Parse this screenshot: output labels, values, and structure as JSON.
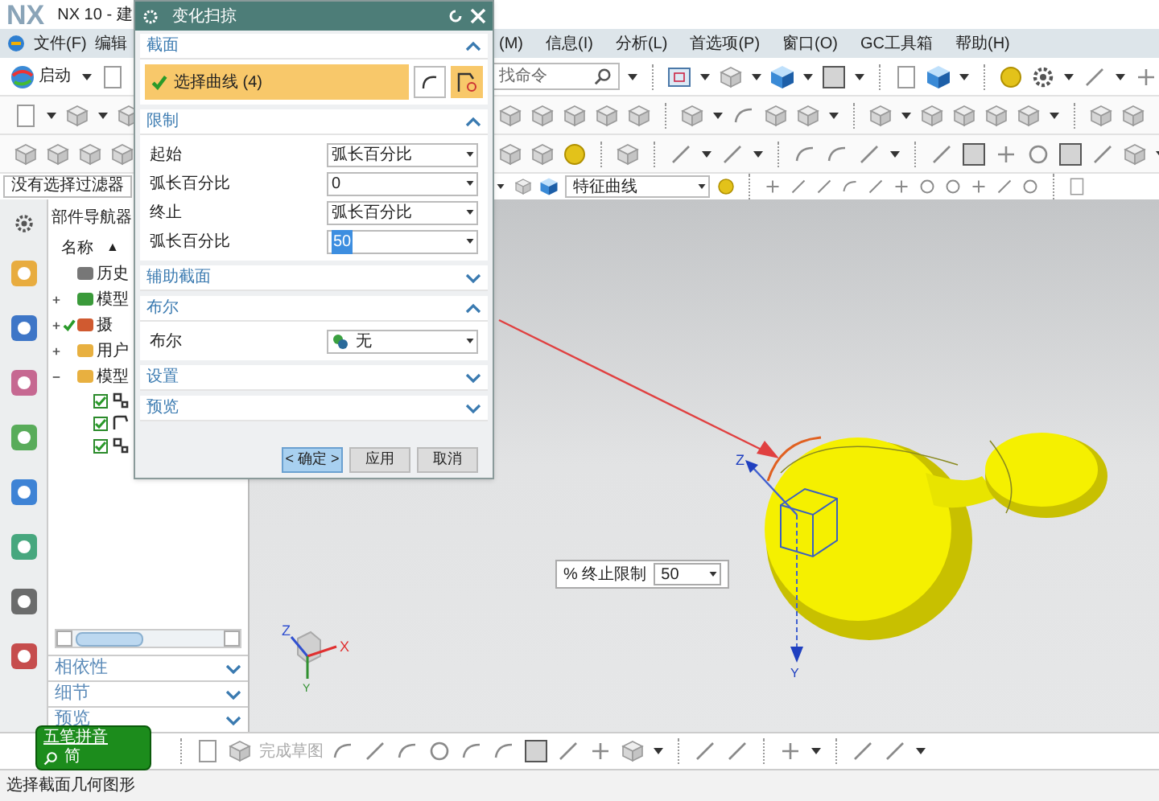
{
  "title_bar": {
    "logo": "NX",
    "title": "NX 10 - 建"
  },
  "menu_left": [
    "文件(F)",
    "编辑"
  ],
  "menu_right": [
    "(M)",
    "信息(I)",
    "分析(L)",
    "首选项(P)",
    "窗口(O)",
    "GC工具箱",
    "帮助(H)"
  ],
  "toolbar": {
    "start": "启动",
    "search": {
      "placeholder": "找命令"
    }
  },
  "selection_bar": {
    "filter": "没有选择过滤器",
    "curve_rule": "特征曲线"
  },
  "navigator": {
    "title": "部件导航器",
    "column": "名称",
    "sort_mark": "▲",
    "tree": [
      {
        "kind": "history",
        "label": "历史",
        "checked": false
      },
      {
        "kind": "views",
        "label": "模型",
        "checked": false,
        "expanded": false
      },
      {
        "kind": "camera",
        "label": "摄",
        "checked": true,
        "expanded": false
      },
      {
        "kind": "folder",
        "label": "用户",
        "checked": false,
        "expanded": false
      },
      {
        "kind": "folder",
        "label": "模型",
        "checked": false,
        "expanded": true,
        "children": [
          {
            "kind": "sketch",
            "checked": true
          },
          {
            "kind": "curve",
            "checked": true
          },
          {
            "kind": "sweep",
            "checked": true
          }
        ]
      }
    ],
    "panels": [
      {
        "label": "相依性",
        "expanded": false
      },
      {
        "label": "细节",
        "expanded": false
      },
      {
        "label": "预览",
        "expanded": false
      }
    ]
  },
  "dialog": {
    "title": "变化扫掠",
    "sections": [
      {
        "kind": "selection",
        "title": "截面",
        "expanded": true,
        "selection": {
          "label": "选择曲线 (4)",
          "done": true
        }
      },
      {
        "kind": "fields",
        "title": "限制",
        "expanded": true,
        "rows": [
          {
            "label": "起始",
            "value": "弧长百分比",
            "highlighted": false
          },
          {
            "label": "弧长百分比",
            "value": "0",
            "highlighted": false
          },
          {
            "label": "终止",
            "value": "弧长百分比",
            "highlighted": false
          },
          {
            "label": "弧长百分比",
            "value": "50",
            "highlighted": true
          }
        ]
      },
      {
        "title": "辅助截面",
        "expanded": false
      },
      {
        "kind": "boolean",
        "title": "布尔",
        "expanded": true,
        "rows": [
          {
            "label": "布尔",
            "value": "无",
            "highlighted": false
          }
        ]
      },
      {
        "title": "设置",
        "expanded": false
      },
      {
        "title": "预览",
        "expanded": false
      }
    ],
    "buttons": [
      {
        "label": "< 确定 >",
        "default": true
      },
      {
        "label": "应用",
        "default": false
      },
      {
        "label": "取消",
        "default": false
      }
    ]
  },
  "viewport": {
    "end_limit": {
      "label": "% 终止限制",
      "value": "50"
    },
    "handle_labels": [
      "Z",
      "Y"
    ],
    "triad_labels": [
      "Z",
      "X",
      "Y"
    ]
  },
  "ime": {
    "name": "五笔拼音",
    "mode": "简"
  },
  "sketch_bar": {
    "finish": "完成草图"
  },
  "status_bar": "选择截面几何图形"
}
